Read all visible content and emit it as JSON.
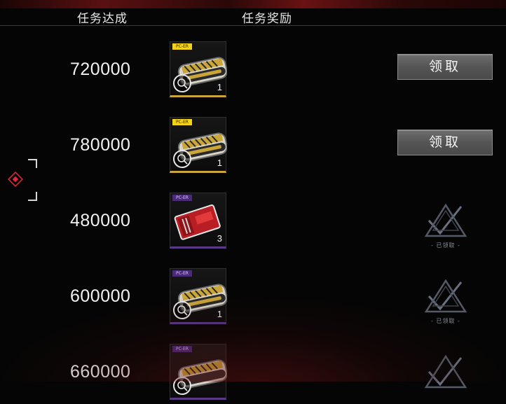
{
  "header": {
    "col_score": "任务达成",
    "col_reward": "任务奖励"
  },
  "colors": {
    "gold_tag": "#f2d21a",
    "purple_tag": "#4b2a7a",
    "button": "#5a5a5a",
    "marker": "#e0283a"
  },
  "rows": [
    {
      "score": "720000",
      "tag": "PC-ER",
      "item": "gold-medal",
      "qty": "1",
      "status": "claim",
      "button_label": "领取"
    },
    {
      "score": "780000",
      "tag": "PC-ER",
      "item": "gold-medal",
      "qty": "1",
      "status": "claim",
      "button_label": "领取"
    },
    {
      "score": "480000",
      "tag": "PC-ER",
      "item": "red-card",
      "qty": "3",
      "status": "claimed",
      "claimed_label": "- 已领取 -"
    },
    {
      "score": "600000",
      "tag": "PC-ER",
      "item": "gold-medal",
      "qty": "1",
      "status": "claimed",
      "claimed_label": "- 已领取 -"
    },
    {
      "score": "660000",
      "tag": "PC-ER",
      "item": "gold-medal",
      "qty": "",
      "status": "claimed",
      "claimed_label": ""
    }
  ]
}
